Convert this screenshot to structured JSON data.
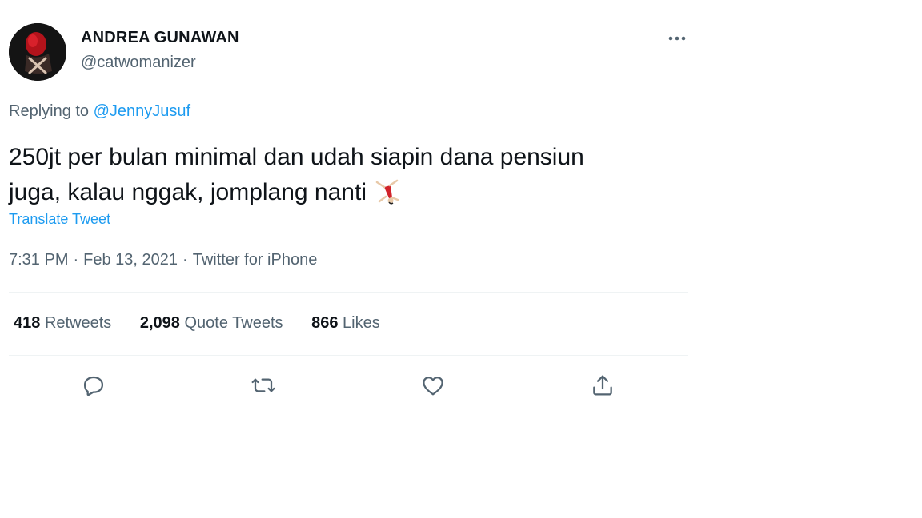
{
  "author": {
    "name": "ANDREA GUNAWAN",
    "handle": "@catwomanizer"
  },
  "reply": {
    "prefix": "Replying to",
    "mention": "@JennyJusuf"
  },
  "tweet": {
    "text_line1": "250jt per bulan minimal dan udah siapin dana pensiun",
    "text_line2": "juga, kalau nggak, jomplang nanti",
    "emoji_icon": "cartwheel-person-icon",
    "translate_label": "Translate Tweet",
    "time": "7:31 PM",
    "date": "Feb 13, 2021",
    "source": "Twitter for iPhone",
    "separator": "·"
  },
  "stats": {
    "retweets_count": "418",
    "retweets_label": "Retweets",
    "quotes_count": "2,098",
    "quotes_label": "Quote Tweets",
    "likes_count": "866",
    "likes_label": "Likes"
  },
  "colors": {
    "link": "#1d9bf0",
    "secondary_text": "#536471",
    "primary_text": "#0f1419",
    "divider": "#eff3f4"
  },
  "icons": [
    "more-options-icon",
    "reply-icon",
    "retweet-icon",
    "like-icon",
    "share-icon"
  ]
}
